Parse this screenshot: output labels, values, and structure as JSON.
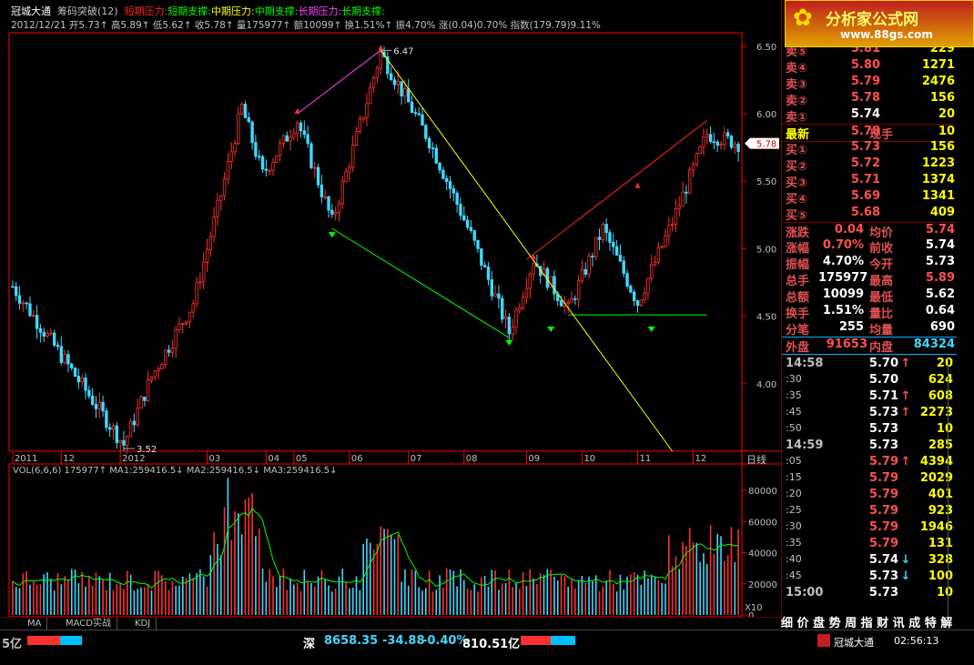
{
  "header": {
    "stock_name": "冠城大通",
    "indicator": "筹码突破(12)",
    "legend": [
      {
        "text": "短期压力:",
        "color": "#ff2020"
      },
      {
        "text": "短期支撑:",
        "color": "#00ff00"
      },
      {
        "text": "中期压力:",
        "color": "#ffff00"
      },
      {
        "text": "中期支撑:",
        "color": "#00ff00"
      },
      {
        "text": "长期压力:",
        "color": "#ff40ff"
      },
      {
        "text": "长期支撑:",
        "color": "#00ff00"
      }
    ],
    "info_line": "2012/12/21  开5.73↑ 高5.89↑ 低5.62↑ 收5.78↑ 量175977↑ 额10099↑ 换1.51%↑ 振4.70%  涨(0.04)0.70% 指数(179.79)9.11%"
  },
  "chart_data": [
    {
      "type": "candlestick",
      "title": "",
      "period_label": "日线",
      "y_ticks": [
        "6.50",
        "6.00",
        "5.50",
        "5.00",
        "4.50",
        "4.00"
      ],
      "ylim": [
        3.5,
        6.6
      ],
      "x_ticks": [
        "2011",
        "12",
        "2012",
        "03",
        "04",
        "05",
        "06",
        "07",
        "08",
        "09",
        "10",
        "11",
        "12"
      ],
      "annotations": [
        {
          "text": "6.47",
          "x_index": 106,
          "value": 6.47
        },
        {
          "text": "3.52",
          "x_index": 32,
          "value": 3.52
        },
        {
          "text": "5.78",
          "value": 5.78,
          "kind": "current-price-tag"
        }
      ],
      "trend_lines": [
        {
          "name": "short-pressure",
          "color": "#ff2020",
          "points": [
            [
              148,
              4.92
            ],
            [
              200,
              5.95
            ]
          ]
        },
        {
          "name": "short-support",
          "color": "#00ff00",
          "points": [
            [
              160,
              4.51
            ],
            [
              200,
              4.51
            ]
          ]
        },
        {
          "name": "mid-pressure",
          "color": "#ffff00",
          "points": [
            [
              106,
              6.47
            ],
            [
              190,
              3.5
            ]
          ]
        },
        {
          "name": "mid-support",
          "color": "#00ff00",
          "points": [
            [
              92,
              5.15
            ],
            [
              143,
              4.34
            ]
          ]
        },
        {
          "name": "long-pressure",
          "color": "#ff40ff",
          "points": [
            [
              82,
              6.0
            ],
            [
              106,
              6.47
            ]
          ]
        }
      ]
    },
    {
      "type": "bar",
      "title": "",
      "indicator_line": "VOL(6,6,6)  175977↑ MA1:259416.5↓ MA2:259416.5↓ MA3:259416.5↓",
      "y_ticks": [
        "80000",
        "60000",
        "40000",
        "20000",
        "0"
      ],
      "ylim": [
        0,
        90000
      ],
      "scale_label": "X10"
    }
  ],
  "quotes": {
    "sell": [
      {
        "label": "卖⑤",
        "price": "5.81",
        "volume": "229"
      },
      {
        "label": "卖④",
        "price": "5.80",
        "volume": "1271"
      },
      {
        "label": "卖③",
        "price": "5.79",
        "volume": "2476"
      },
      {
        "label": "卖②",
        "price": "5.78",
        "volume": "156"
      },
      {
        "label": "卖①",
        "price": "5.74",
        "volume": "20"
      }
    ],
    "latest": {
      "label": "最新",
      "price": "5.78",
      "label2": "现手",
      "volume": "10"
    },
    "buy": [
      {
        "label": "买①",
        "price": "5.73",
        "volume": "156"
      },
      {
        "label": "买②",
        "price": "5.72",
        "volume": "1223"
      },
      {
        "label": "买③",
        "price": "5.71",
        "volume": "1374"
      },
      {
        "label": "买④",
        "price": "5.69",
        "volume": "1341"
      },
      {
        "label": "买⑤",
        "price": "5.68",
        "volume": "409"
      }
    ]
  },
  "stats": [
    {
      "l1": "涨跌",
      "v1": "0.04",
      "l2": "均价",
      "v2": "5.74"
    },
    {
      "l1": "涨幅",
      "v1": "0.70%",
      "l2": "前收",
      "v2": "5.74"
    },
    {
      "l1": "振幅",
      "v1": "4.70%",
      "l2": "今开",
      "v2": "5.73"
    },
    {
      "l1": "总手",
      "v1": "175977",
      "l2": "最高",
      "v2": "5.89"
    },
    {
      "l1": "总额",
      "v1": "10099",
      "l2": "最低",
      "v2": "5.62"
    },
    {
      "l1": "换手",
      "v1": "1.51%",
      "l2": "量比",
      "v2": "0.64"
    },
    {
      "l1": "分笔",
      "v1": "255",
      "l2": "均量",
      "v2": "690"
    }
  ],
  "outer_inner": {
    "outer_label": "外盘",
    "outer_value": "91653",
    "inner_label": "内盘",
    "inner_value": "84324"
  },
  "ticks": [
    {
      "time": "14:58",
      "price": "5.70",
      "arrow": "↑",
      "volume": "20",
      "big": true,
      "color": "white"
    },
    {
      "time": ":30",
      "price": "5.70",
      "arrow": "",
      "volume": "624",
      "color": "white"
    },
    {
      "time": ":35",
      "price": "5.71",
      "arrow": "↑",
      "volume": "608",
      "color": "white"
    },
    {
      "time": ":45",
      "price": "5.73",
      "arrow": "↑",
      "volume": "2273",
      "color": "white"
    },
    {
      "time": ":50",
      "price": "5.73",
      "arrow": "",
      "volume": "10",
      "color": "white"
    },
    {
      "time": "14:59",
      "price": "5.73",
      "arrow": "",
      "volume": "285",
      "big": true,
      "color": "white"
    },
    {
      "time": ":05",
      "price": "5.79",
      "arrow": "↑",
      "volume": "4394",
      "color": "red"
    },
    {
      "time": ":15",
      "price": "5.79",
      "arrow": "",
      "volume": "2029",
      "color": "red"
    },
    {
      "time": ":20",
      "price": "5.79",
      "arrow": "",
      "volume": "401",
      "color": "red"
    },
    {
      "time": ":25",
      "price": "5.79",
      "arrow": "",
      "volume": "923",
      "color": "red"
    },
    {
      "time": ":30",
      "price": "5.79",
      "arrow": "",
      "volume": "1946",
      "color": "red"
    },
    {
      "time": ":35",
      "price": "5.79",
      "arrow": "",
      "volume": "131",
      "color": "red"
    },
    {
      "time": ":40",
      "price": "5.74",
      "arrow": "↓",
      "volume": "328",
      "color": "white"
    },
    {
      "time": ":45",
      "price": "5.73",
      "arrow": "↓",
      "volume": "100",
      "color": "white"
    },
    {
      "time": "15:00",
      "price": "5.73",
      "arrow": "",
      "volume": "10",
      "big": true,
      "color": "white"
    }
  ],
  "tabs": [
    "MA",
    "MACD实战",
    "KDJ"
  ],
  "logo": {
    "text": "分析家公式网",
    "url_text": "www.88gs.com"
  },
  "right_tabs_text": "细 价 盘 势 周 指 财 讯 成 特 解",
  "status_bar": {
    "left_amount": "5亿",
    "index_name": "深",
    "index_value": "8658.35",
    "index_change": "-34.88",
    "index_pct": "-0.40%",
    "index_amount": "810.51亿",
    "taskbar_item": "冠城大通",
    "clock": "02:56:13"
  },
  "colors": {
    "up": "#ff3030",
    "down": "#40d8ff",
    "ma1": "#ffffff",
    "ma2": "#ff40ff",
    "ma3": "#00ff00",
    "axis": "#ff0000",
    "logo": "#c02020"
  }
}
